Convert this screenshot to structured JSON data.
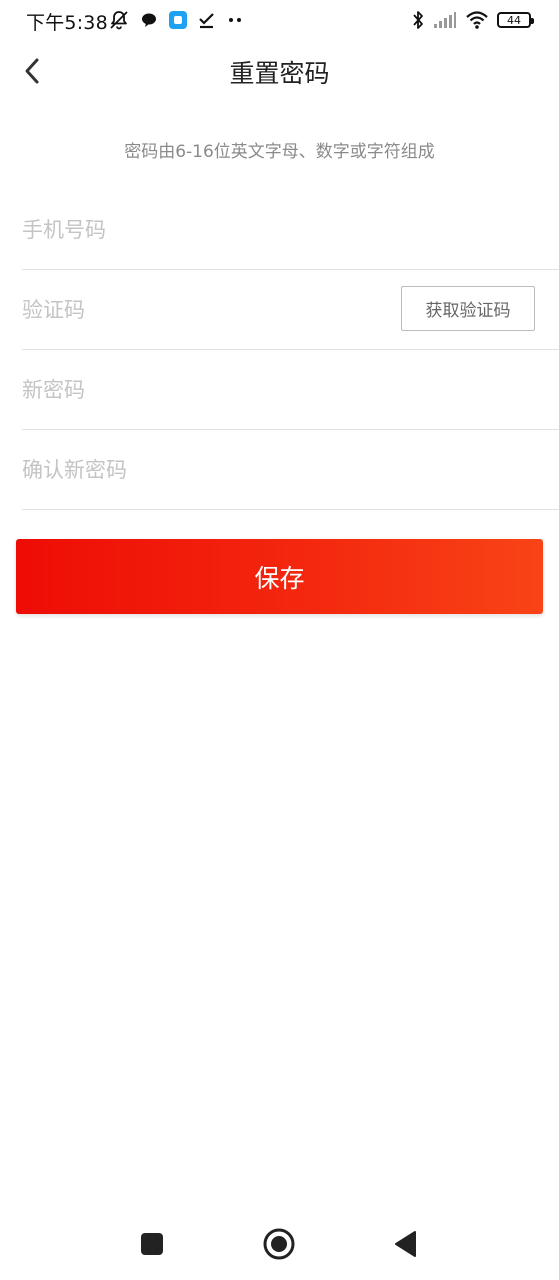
{
  "status_bar": {
    "time": "下午5:38",
    "left_icons": [
      "mute-bell-icon",
      "chat-bubble-icon",
      "app-square-icon",
      "checkmark-icon",
      "more-dots-icon"
    ],
    "right_icons": [
      "bluetooth-icon",
      "signal-icon",
      "wifi-icon",
      "battery-icon"
    ],
    "battery_level": "44"
  },
  "header": {
    "title": "重置密码",
    "back_icon": "chevron-left-icon"
  },
  "hint": "密码由6-16位英文字母、数字或字符组成",
  "form": {
    "phone": {
      "placeholder": "手机号码",
      "value": ""
    },
    "code": {
      "placeholder": "验证码",
      "value": "",
      "button_label": "获取验证码"
    },
    "new_password": {
      "placeholder": "新密码",
      "value": ""
    },
    "confirm_password": {
      "placeholder": "确认新密码",
      "value": ""
    }
  },
  "save_button": {
    "label": "保存",
    "gradient_start": "#ee0c05",
    "gradient_end": "#f84416"
  },
  "nav_bar": {
    "icons": [
      "square-icon",
      "home-circle-icon",
      "back-triangle-icon"
    ]
  }
}
